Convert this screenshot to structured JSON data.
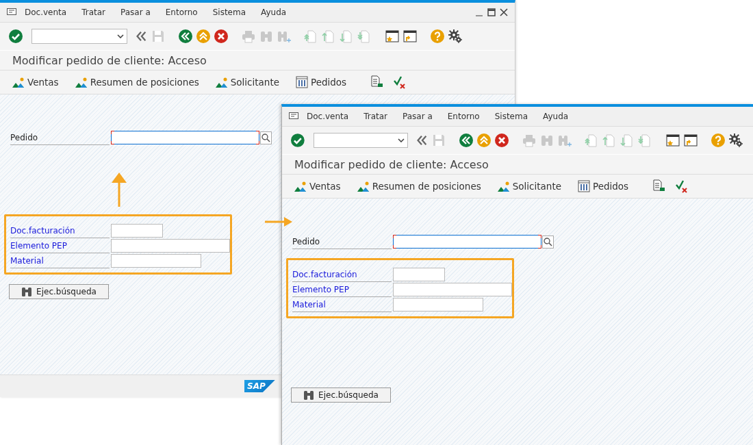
{
  "windows": [
    {
      "menu": [
        "Doc.venta",
        "Tratar",
        "Pasar a",
        "Entorno",
        "Sistema",
        "Ayuda"
      ],
      "window_controls": true,
      "title": "Modificar pedido de cliente: Acceso",
      "app_toolbar": [
        {
          "kind": "mountain",
          "label": "Ventas"
        },
        {
          "kind": "mountain",
          "label": "Resumen de posiciones"
        },
        {
          "kind": "mountain",
          "label": "Solicitante"
        },
        {
          "kind": "columns",
          "label": "Pedidos"
        },
        {
          "kind": "document"
        },
        {
          "kind": "check"
        }
      ],
      "order_field": {
        "label": "Pedido",
        "focused": true
      },
      "highlighted_fields": [
        {
          "label": "Doc.facturación",
          "focused": false
        },
        {
          "label": "Elemento PEP",
          "focused": false
        },
        {
          "label": "Material",
          "focused": false
        }
      ],
      "search_button": "Ejec.búsqueda",
      "footer_logo": "SAP"
    },
    {
      "menu": [
        "Doc.venta",
        "Tratar",
        "Pasar a",
        "Entorno",
        "Sistema",
        "Ayuda"
      ],
      "window_controls": false,
      "title": "Modificar pedido de cliente: Acceso",
      "app_toolbar": [
        {
          "kind": "mountain",
          "label": "Ventas"
        },
        {
          "kind": "mountain",
          "label": "Resumen de posiciones"
        },
        {
          "kind": "mountain",
          "label": "Solicitante"
        },
        {
          "kind": "columns",
          "label": "Pedidos"
        },
        {
          "kind": "document"
        },
        {
          "kind": "check"
        }
      ],
      "order_field": {
        "label": "Pedido",
        "focused": true
      },
      "highlighted_fields": [
        {
          "label": "Doc.facturación",
          "focused": false
        },
        {
          "label": "Elemento PEP",
          "focused": false
        },
        {
          "label": "Material",
          "focused": false
        }
      ],
      "search_button": "Ejec.búsqueda"
    }
  ]
}
